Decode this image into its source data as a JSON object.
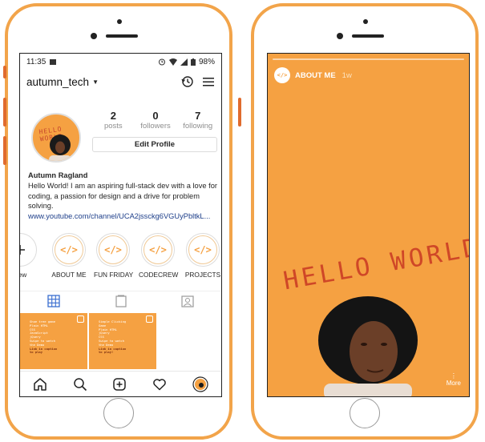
{
  "status_bar": {
    "time": "11:35",
    "battery": "98%"
  },
  "profile": {
    "username": "autumn_tech",
    "avatar_text": "HELLO WORLD",
    "stats": [
      {
        "num": "2",
        "label": "posts"
      },
      {
        "num": "0",
        "label": "followers"
      },
      {
        "num": "7",
        "label": "following"
      }
    ],
    "edit_label": "Edit Profile",
    "name": "Autumn Ragland",
    "bio": "Hello World! I am an aspiring full-stack dev with a love for coding, a passion for design and a drive for problem solving.",
    "link": "www.youtube.com/channel/UCA2jssckg6VGUyPbltkL..."
  },
  "highlights": {
    "new_label": "New",
    "items": [
      {
        "label": "ABOUT ME",
        "icon": "code-icon"
      },
      {
        "label": "FUN FRIDAY",
        "icon": "code-icon"
      },
      {
        "label": "CODECREW",
        "icon": "code-icon"
      },
      {
        "label": "PROJECTS",
        "icon": "code-icon"
      }
    ],
    "icon_text": "</>"
  },
  "posts": [
    {
      "lines": [
        "Shoe tree game",
        "Plain HTML",
        "CSS",
        "JavaScript",
        "jQuery",
        "Swipe to watch",
        "the Demo"
      ],
      "accent_lines": [
        "Link in caption",
        "to play"
      ]
    },
    {
      "lines": [
        "Simple Clicking",
        "Game",
        "Plain HTML",
        "jQuery",
        "CSS",
        "Swipe to watch",
        "the Demo"
      ],
      "accent_lines": [
        "Link in caption",
        "to play!"
      ]
    }
  ],
  "story": {
    "title": "ABOUT ME",
    "time": "1w",
    "avatar_text": "</>",
    "headline": "HELLO WORLD",
    "more_label": "More"
  },
  "colors": {
    "accent": "#f5a142",
    "frame": "#f2a44a",
    "text_red": "#cf4727",
    "link": "#1e3f8a"
  }
}
